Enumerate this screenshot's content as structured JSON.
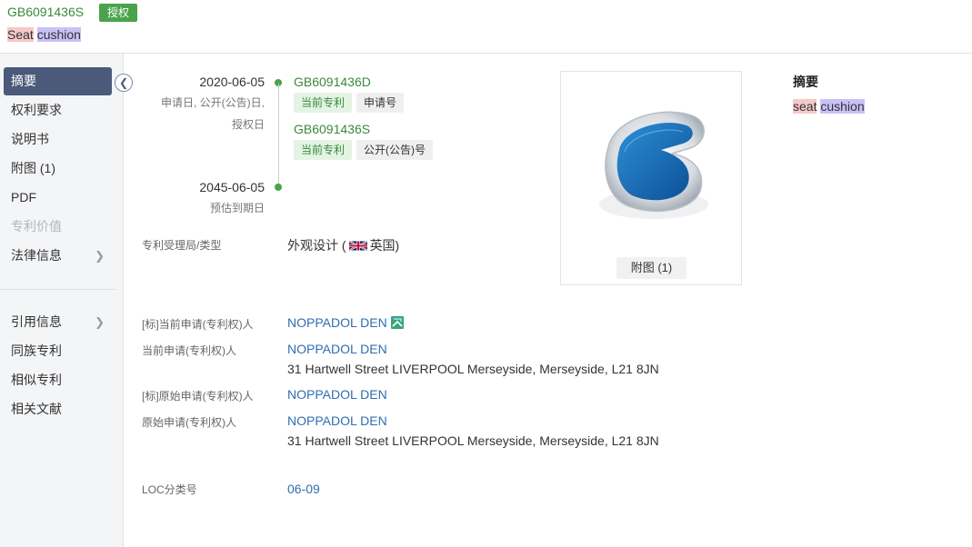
{
  "header": {
    "pub_no": "GB6091436S",
    "status": "授权",
    "title_word1": "Seat",
    "title_word2": "cushion"
  },
  "sidebar": {
    "items": [
      {
        "label": "摘要"
      },
      {
        "label": "权利要求"
      },
      {
        "label": "说明书"
      },
      {
        "label": "附图 (1)"
      },
      {
        "label": "PDF"
      },
      {
        "label": "专利价值"
      },
      {
        "label": "法律信息"
      },
      {
        "label": "引用信息"
      },
      {
        "label": "同族专利"
      },
      {
        "label": "相似专利"
      },
      {
        "label": "相关文献"
      }
    ]
  },
  "timeline": {
    "start_date": "2020-06-05",
    "start_label_1": "申请日, 公开(公告)日,",
    "start_label_2": "授权日",
    "end_date": "2045-06-05",
    "end_label": "预估到期日",
    "entries": [
      {
        "number": "GB6091436D",
        "tag1": "当前专利",
        "tag2": "申请号"
      },
      {
        "number": "GB6091436S",
        "tag1": "当前专利",
        "tag2": "公开(公告)号"
      }
    ]
  },
  "fields": {
    "office_label": "专利受理局/类型",
    "office_type": "外观设计 (",
    "office_country": "英国)",
    "std_current_label": "[标]当前申请(专利权)人",
    "std_current_value": "NOPPADOL DEN",
    "current_label": "当前申请(专利权)人",
    "current_value": "NOPPADOL DEN",
    "current_address": "31 Hartwell Street LIVERPOOL Merseyside, Merseyside, L21 8JN",
    "std_original_label": "[标]原始申请(专利权)人",
    "std_original_value": "NOPPADOL DEN",
    "original_label": "原始申请(专利权)人",
    "original_value": "NOPPADOL DEN",
    "original_address": "31 Hartwell Street LIVERPOOL Merseyside, Merseyside, L21 8JN",
    "loc_label": "LOC分类号",
    "loc_value": "06-09"
  },
  "figure": {
    "button_label": "附图 (1)"
  },
  "abstract": {
    "title": "摘要",
    "word1": "seat",
    "word2": "cushion"
  },
  "colors": {
    "accent_green": "#4aa34a",
    "link_blue": "#2f6fb1",
    "nav_active": "#4b5a7a"
  }
}
